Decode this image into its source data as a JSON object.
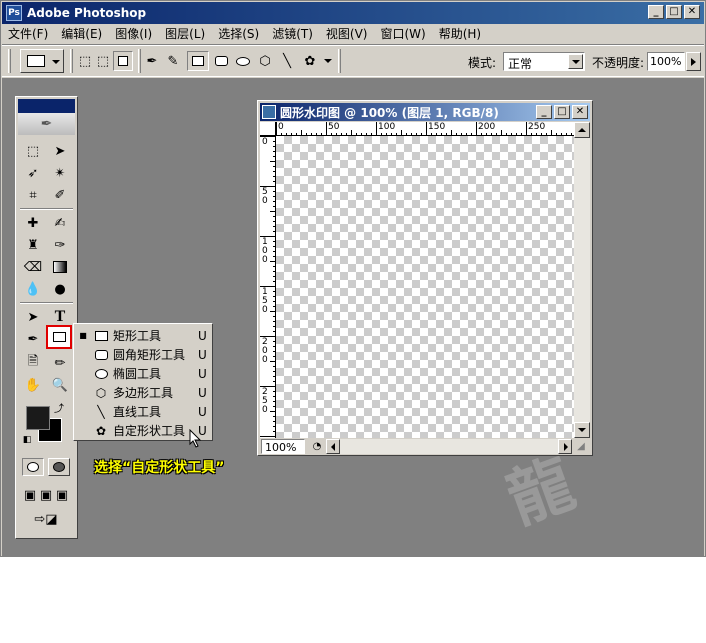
{
  "app": {
    "title": "Adobe Photoshop"
  },
  "window_controls": {
    "minimize": "_",
    "maximize": "□",
    "close": "✕"
  },
  "menu": [
    "文件(F)",
    "编辑(E)",
    "图像(I)",
    "图层(L)",
    "选择(S)",
    "滤镜(T)",
    "视图(V)",
    "窗口(W)",
    "帮助(H)"
  ],
  "options": {
    "mode_label": "模式:",
    "mode_value": "正常",
    "opacity_label": "不透明度:",
    "opacity_value": "100%"
  },
  "document": {
    "title": "圆形水印图 @ 100% (图层 1, RGB/8)",
    "zoom": "100%",
    "ruler_h": [
      "0",
      "50",
      "100",
      "150",
      "200",
      "250"
    ],
    "ruler_v": [
      "0",
      "5\n0",
      "1\n0\n0",
      "1\n5\n0",
      "2\n0\n0",
      "2\n5\n0"
    ]
  },
  "flyout": {
    "items": [
      {
        "label": "矩形工具",
        "key": "U",
        "icon": "rectangle-icon",
        "active": true
      },
      {
        "label": "圆角矩形工具",
        "key": "U",
        "icon": "rounded-rectangle-icon",
        "active": false
      },
      {
        "label": "椭圆工具",
        "key": "U",
        "icon": "ellipse-icon",
        "active": false
      },
      {
        "label": "多边形工具",
        "key": "U",
        "icon": "polygon-icon",
        "active": false
      },
      {
        "label": "直线工具",
        "key": "U",
        "icon": "line-icon",
        "active": false
      },
      {
        "label": "自定形状工具",
        "key": "U",
        "icon": "custom-shape-icon",
        "active": false
      }
    ]
  },
  "caption": "选择“自定形状工具”",
  "colors": {
    "title_bar": "#0a246a",
    "workspace": "#808080",
    "panel": "#d4d0c8",
    "highlight": "#e00000",
    "caption": "#ffff00"
  }
}
